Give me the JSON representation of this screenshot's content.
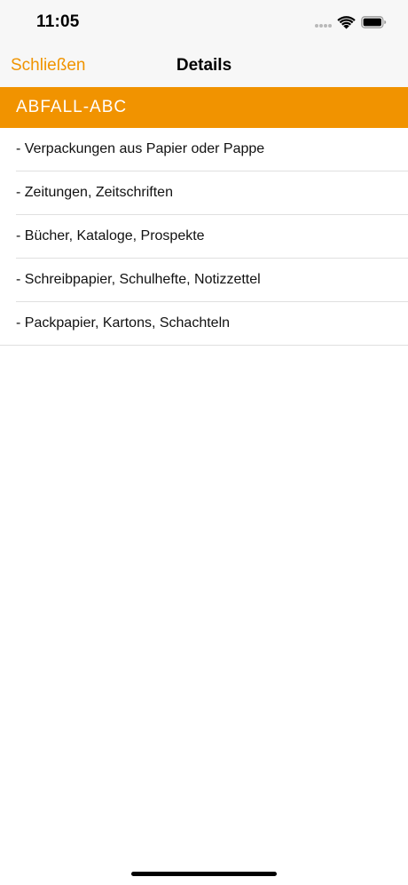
{
  "status_bar": {
    "time": "11:05",
    "icons": [
      "signal-dots-icon",
      "wifi-icon",
      "battery-icon"
    ]
  },
  "nav": {
    "close_label": "Schließen",
    "title": "Details"
  },
  "section": {
    "title": "ABFALL-ABC"
  },
  "items": [
    {
      "label": "- Verpackungen aus Papier oder Pappe"
    },
    {
      "label": "- Zeitungen, Zeitschriften"
    },
    {
      "label": "- Bücher, Kataloge, Prospekte"
    },
    {
      "label": "- Schreibpapier, Schulhefte, Notizzettel"
    },
    {
      "label": "- Packpapier, Kartons, Schachteln"
    }
  ],
  "colors": {
    "accent": "#f09400",
    "header_background": "#f19300",
    "bar_background": "#f7f7f7",
    "separator": "#e0e0e0"
  }
}
